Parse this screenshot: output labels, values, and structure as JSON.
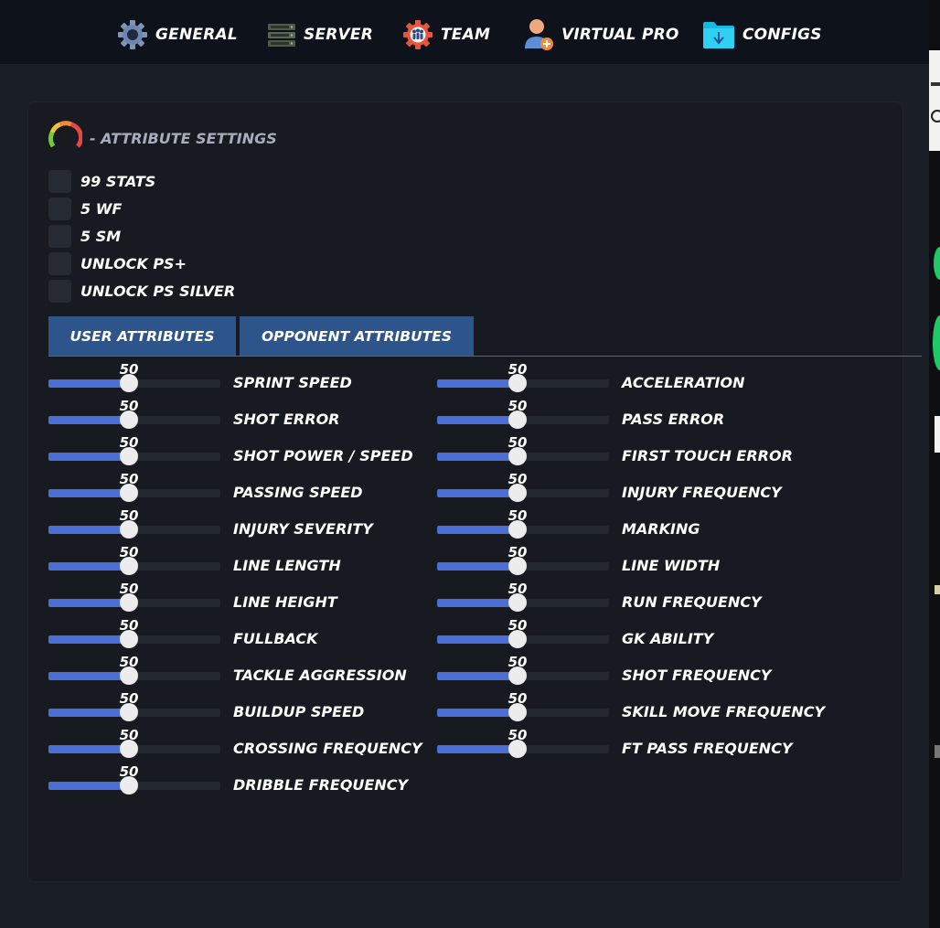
{
  "nav": {
    "items": [
      {
        "label": "GENERAL",
        "icon": "gear-icon"
      },
      {
        "label": "SERVER",
        "icon": "server-rack-icon"
      },
      {
        "label": "TEAM",
        "icon": "team-icon"
      },
      {
        "label": "VIRTUAL PRO",
        "icon": "user-add-icon"
      },
      {
        "label": "CONFIGS",
        "icon": "folder-download-icon"
      }
    ]
  },
  "attribute_settings": {
    "title": "- ATTRIBUTE SETTINGS",
    "icon": "gauge-icon",
    "checkboxes": [
      {
        "label": "99 STATS",
        "checked": false
      },
      {
        "label": "5 WF",
        "checked": false
      },
      {
        "label": "5 SM",
        "checked": false
      },
      {
        "label": "UNLOCK PS+",
        "checked": false
      },
      {
        "label": "UNLOCK PS SILVER",
        "checked": false
      }
    ]
  },
  "tabs": [
    {
      "label": "USER ATTRIBUTES",
      "active": true
    },
    {
      "label": "OPPONENT ATTRIBUTES",
      "active": false
    }
  ],
  "slider_scale": {
    "min": 0,
    "max": 100
  },
  "sliders_left": [
    {
      "label": "SPRINT SPEED",
      "value": 50
    },
    {
      "label": "SHOT ERROR",
      "value": 50
    },
    {
      "label": "SHOT POWER / SPEED",
      "value": 50
    },
    {
      "label": "PASSING SPEED",
      "value": 50
    },
    {
      "label": "INJURY SEVERITY",
      "value": 50
    },
    {
      "label": "LINE LENGTH",
      "value": 50
    },
    {
      "label": "LINE HEIGHT",
      "value": 50
    },
    {
      "label": "FULLBACK",
      "value": 50
    },
    {
      "label": "TACKLE AGGRESSION",
      "value": 50
    },
    {
      "label": "BUILDUP SPEED",
      "value": 50
    },
    {
      "label": "CROSSING FREQUENCY",
      "value": 50
    },
    {
      "label": "DRIBBLE FREQUENCY",
      "value": 50
    }
  ],
  "sliders_right": [
    {
      "label": "ACCELERATION",
      "value": 50
    },
    {
      "label": "PASS ERROR",
      "value": 50
    },
    {
      "label": "FIRST TOUCH ERROR",
      "value": 50
    },
    {
      "label": "INJURY FREQUENCY",
      "value": 50
    },
    {
      "label": "MARKING",
      "value": 50
    },
    {
      "label": "LINE WIDTH",
      "value": 50
    },
    {
      "label": "RUN FREQUENCY",
      "value": 50
    },
    {
      "label": "GK ABILITY",
      "value": 50
    },
    {
      "label": "SHOT FREQUENCY",
      "value": 50
    },
    {
      "label": "SKILL MOVE FREQUENCY",
      "value": 50
    },
    {
      "label": "FT PASS FREQUENCY",
      "value": 50
    }
  ],
  "colors": {
    "accent": "#4c6fd6",
    "tab_bg": "#2e548c",
    "panel_bg": "#171a20",
    "nav_bg": "#0d121b"
  }
}
